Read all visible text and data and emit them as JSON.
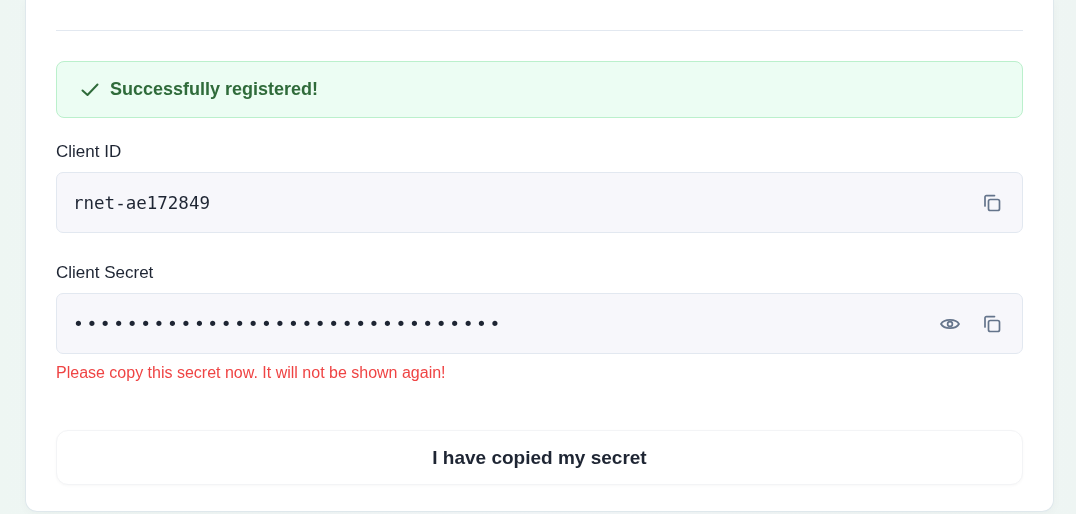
{
  "alert": {
    "kind": "success",
    "message": "Successfully registered!"
  },
  "fields": [
    {
      "label": "Client ID",
      "value": "rnet-ae172849",
      "kind": "plain"
    },
    {
      "label": "Client Secret",
      "value": "••••••••••••••••••••••••••••••••",
      "kind": "secret"
    }
  ],
  "warning": "Please copy this secret now. It will not be shown again!",
  "confirm_button": "I have copied my secret"
}
